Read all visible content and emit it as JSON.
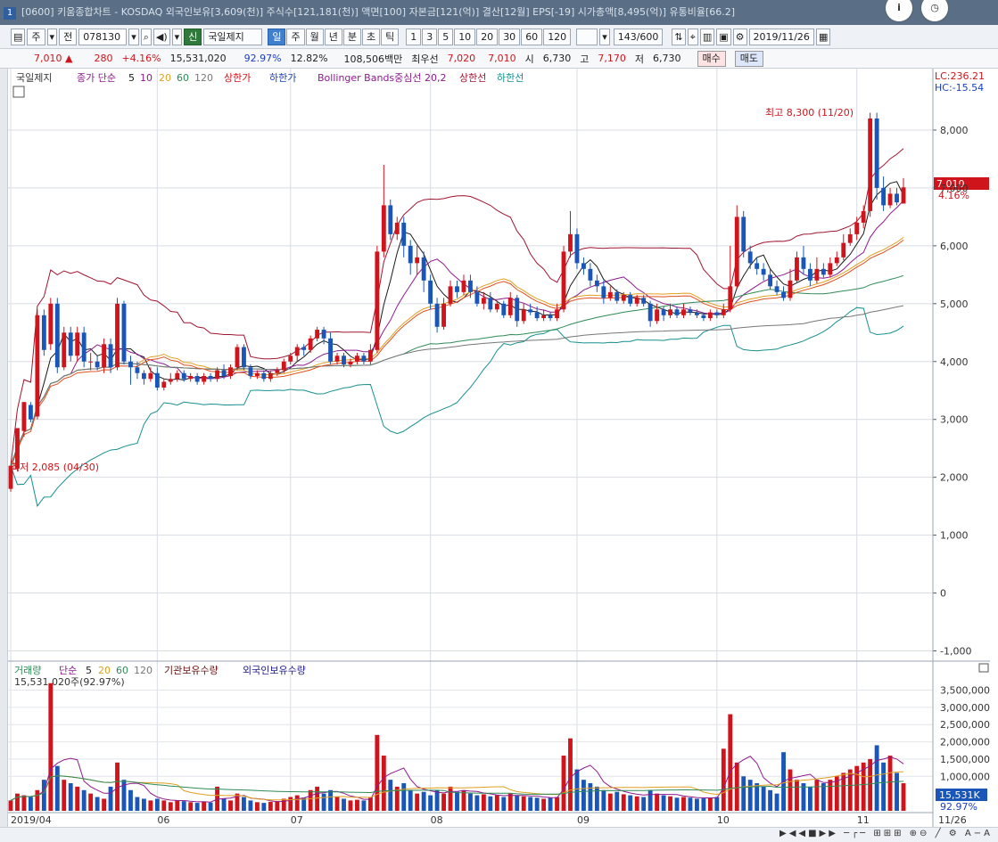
{
  "window": {
    "number": "1",
    "title": "[0600] 키움종합차트 - KOSDAQ 외국인보유[3,609(천)] 주식수[121,181(천)] 액면[100] 자본금[121(억)] 결산[12월] EPS[-19] 시가총액[8,495(억)] 유통비율[66.2]"
  },
  "toolbar": {
    "period_select": "주",
    "range_button": "전",
    "code": "078130",
    "stock_name": "국일제지",
    "period_buttons": [
      "일",
      "주",
      "월",
      "년",
      "분",
      "초",
      "틱"
    ],
    "selected_period": "일",
    "intervals": [
      "1",
      "3",
      "5",
      "10",
      "20",
      "30",
      "60",
      "120"
    ],
    "count": "143/600",
    "date": "2019/11/26",
    "new_badge": "신"
  },
  "quote": {
    "price": "7,010",
    "arrow": "▲",
    "change": "280",
    "change_pct": "+4.16%",
    "volume": "15,531,020",
    "volume_ratio": "92.97%",
    "turnover": "12.82%",
    "amount": "108,506백만",
    "best_ask_label": "최우선",
    "best_ask": "7,020",
    "best_bid": "7,010",
    "open_label": "시",
    "open": "6,730",
    "high_label": "고",
    "high": "7,170",
    "low_label": "저",
    "low": "6,730",
    "buy": "매수",
    "sell": "매도"
  },
  "legend": {
    "name": "국일제지",
    "close_ma": "종가 단순",
    "ma_periods": [
      "5",
      "10",
      "20",
      "60",
      "120"
    ],
    "upper_limit": "상한가",
    "lower_limit": "하한가",
    "bollinger": "Bollinger Bands중심선 20,2",
    "bb_upper": "상한선",
    "bb_lower": "하한선",
    "lc": "LC:236.21",
    "hc": "HC:-15.54"
  },
  "volume_legend": {
    "name": "거래량",
    "ma": "단순",
    "periods": [
      "5",
      "20",
      "60",
      "120"
    ],
    "inst": "기관보유수량",
    "foreign": "외국인보유수량",
    "current": "15,531,020주(92.97%)"
  },
  "annotations": {
    "high": "최고 8,300 (11/20)",
    "low": "최저 2,085 (04/30)",
    "current_price": "7,010",
    "current_pct": "4.16%",
    "current_volume": "15,531K",
    "current_volume_pct": "92.97%"
  },
  "colors": {
    "up": "#d0141b",
    "down": "#1a56b8",
    "ma5": "#1a1a1a",
    "ma10": "#8e1a8e",
    "ma20": "#e0a020",
    "ma60": "#2e8b57",
    "ma120": "#777777",
    "bb_upper": "#a01530",
    "bb_lower": "#178f8f",
    "inst": "#6b0f0f",
    "foreign": "#1e1a8c"
  },
  "chart_data": {
    "type": "candlestick",
    "y_axis_ticks": [
      "8,000",
      "7,000",
      "6,000",
      "5,000",
      "4,000",
      "3,000",
      "2,000",
      "1,000",
      "0",
      "-1,000"
    ],
    "ylim": [
      -1100,
      8600
    ],
    "x_axis_labels": [
      "2019/04",
      "06",
      "07",
      "08",
      "09",
      "10",
      "11",
      "11/26"
    ],
    "volume_axis_ticks": [
      "3,500,000",
      "3,000,000",
      "2,500,000",
      "2,000,000",
      "1,500,000",
      "1,000,000"
    ],
    "vol_ylim": [
      0,
      3900000
    ],
    "candles": [
      [
        1800,
        2200,
        1750,
        2150
      ],
      [
        2150,
        2850,
        2100,
        2800
      ],
      [
        2800,
        3300,
        2700,
        3250
      ],
      [
        3250,
        3000,
        2950,
        3300
      ],
      [
        3050,
        4800,
        3000,
        4900
      ],
      [
        4800,
        4200,
        4100,
        4900
      ],
      [
        4300,
        5000,
        4200,
        5100
      ],
      [
        5000,
        3900,
        3800,
        5100
      ],
      [
        3900,
        4500,
        3850,
        4600
      ],
      [
        4500,
        4100,
        4000,
        4600
      ],
      [
        4100,
        4500,
        4000,
        4600
      ],
      [
        4500,
        4000,
        3900,
        4600
      ],
      [
        4000,
        4000,
        3850,
        4150
      ],
      [
        4000,
        3900,
        3850,
        4100
      ],
      [
        3900,
        4300,
        3800,
        4400
      ],
      [
        4300,
        3900,
        3800,
        4400
      ],
      [
        3900,
        5000,
        3850,
        5100
      ],
      [
        5000,
        4000,
        3950,
        5050
      ],
      [
        4000,
        3900,
        3600,
        4100
      ],
      [
        3900,
        3800,
        3700,
        4000
      ],
      [
        3800,
        3700,
        3600,
        3850
      ],
      [
        3700,
        3800,
        3650,
        3900
      ],
      [
        3800,
        3550,
        3500,
        3900
      ],
      [
        3550,
        3650,
        3500,
        3700
      ],
      [
        3650,
        3700,
        3600,
        3800
      ],
      [
        3700,
        3800,
        3650,
        3850
      ],
      [
        3800,
        3700,
        3650,
        3850
      ],
      [
        3700,
        3750,
        3650,
        3800
      ],
      [
        3750,
        3650,
        3600,
        3800
      ],
      [
        3650,
        3750,
        3600,
        3800
      ],
      [
        3750,
        3700,
        3650,
        3800
      ],
      [
        3700,
        3850,
        3650,
        3900
      ],
      [
        3850,
        3750,
        3700,
        3950
      ],
      [
        3750,
        3900,
        3700,
        3950
      ],
      [
        3900,
        4250,
        3850,
        4300
      ],
      [
        4250,
        3900,
        3850,
        4300
      ],
      [
        3900,
        3750,
        3700,
        3950
      ],
      [
        3750,
        3800,
        3700,
        3850
      ],
      [
        3800,
        3700,
        3650,
        3850
      ],
      [
        3700,
        3800,
        3650,
        3850
      ],
      [
        3800,
        3850,
        3750,
        3900
      ],
      [
        3850,
        4000,
        3800,
        4050
      ],
      [
        4000,
        4100,
        3950,
        4150
      ],
      [
        4100,
        4250,
        4000,
        4300
      ],
      [
        4250,
        4200,
        4100,
        4300
      ],
      [
        4200,
        4400,
        4150,
        4450
      ],
      [
        4400,
        4550,
        4350,
        4600
      ],
      [
        4550,
        4400,
        4300,
        4600
      ],
      [
        4400,
        4000,
        3950,
        4500
      ],
      [
        4000,
        4100,
        3950,
        4150
      ],
      [
        4100,
        3950,
        3900,
        4150
      ],
      [
        3950,
        4000,
        3900,
        4050
      ],
      [
        4000,
        4100,
        3950,
        4150
      ],
      [
        4100,
        4000,
        3950,
        4150
      ],
      [
        4000,
        4200,
        3950,
        4300
      ],
      [
        4200,
        5900,
        4150,
        6000
      ],
      [
        5900,
        6700,
        5800,
        7400
      ],
      [
        6700,
        6200,
        6100,
        6800
      ],
      [
        6200,
        6400,
        6100,
        6500
      ],
      [
        6400,
        6000,
        5800,
        6500
      ],
      [
        6000,
        5700,
        5500,
        6100
      ],
      [
        5700,
        5800,
        5500,
        6000
      ],
      [
        5800,
        5400,
        5200,
        5900
      ],
      [
        5400,
        5000,
        4900,
        5500
      ],
      [
        5000,
        4600,
        4500,
        5100
      ],
      [
        4600,
        5000,
        4550,
        5100
      ],
      [
        5000,
        5300,
        4950,
        5400
      ],
      [
        5300,
        5200,
        5100,
        5400
      ],
      [
        5200,
        5400,
        5150,
        5500
      ],
      [
        5400,
        5200,
        5100,
        5500
      ],
      [
        5200,
        5000,
        4950,
        5300
      ],
      [
        5000,
        5100,
        4900,
        5200
      ],
      [
        5100,
        4900,
        4850,
        5200
      ],
      [
        4900,
        5000,
        4850,
        5050
      ],
      [
        5000,
        4800,
        4750,
        5050
      ],
      [
        4800,
        5100,
        4750,
        5200
      ],
      [
        5100,
        4700,
        4600,
        5150
      ],
      [
        4700,
        4900,
        4650,
        5000
      ],
      [
        4900,
        4850,
        4800,
        5000
      ],
      [
        4850,
        4750,
        4700,
        4950
      ],
      [
        4750,
        4800,
        4700,
        4900
      ],
      [
        4800,
        4750,
        4700,
        4850
      ],
      [
        4750,
        4900,
        4700,
        5000
      ],
      [
        4900,
        5900,
        4850,
        6000
      ],
      [
        5900,
        6200,
        5800,
        6600
      ],
      [
        6200,
        5700,
        5600,
        6300
      ],
      [
        5700,
        5600,
        5500,
        5800
      ],
      [
        5600,
        5400,
        5300,
        5700
      ],
      [
        5400,
        5300,
        5200,
        5500
      ],
      [
        5300,
        5100,
        5000,
        5400
      ],
      [
        5100,
        5200,
        5050,
        5300
      ],
      [
        5200,
        5050,
        5000,
        5250
      ],
      [
        5050,
        5150,
        5000,
        5200
      ],
      [
        5150,
        5000,
        4950,
        5200
      ],
      [
        5000,
        5100,
        4950,
        5150
      ],
      [
        5100,
        5000,
        4950,
        5150
      ],
      [
        5000,
        4700,
        4600,
        5050
      ],
      [
        4700,
        4900,
        4650,
        5000
      ],
      [
        4900,
        4800,
        4700,
        4950
      ],
      [
        4800,
        4900,
        4750,
        5000
      ],
      [
        4900,
        4800,
        4750,
        4950
      ],
      [
        4800,
        4900,
        4750,
        5000
      ],
      [
        4900,
        4850,
        4800,
        4950
      ],
      [
        4850,
        4800,
        4750,
        4900
      ],
      [
        4800,
        4750,
        4700,
        4850
      ],
      [
        4750,
        4850,
        4700,
        4900
      ],
      [
        4850,
        4800,
        4750,
        4900
      ],
      [
        4800,
        4900,
        4750,
        5000
      ],
      [
        4900,
        5300,
        4850,
        6000
      ],
      [
        5300,
        6500,
        5250,
        6700
      ],
      [
        6500,
        5900,
        5800,
        6600
      ],
      [
        5900,
        5700,
        5600,
        6000
      ],
      [
        5700,
        5600,
        5500,
        5800
      ],
      [
        5600,
        5500,
        5400,
        5700
      ],
      [
        5500,
        5300,
        5250,
        5600
      ],
      [
        5300,
        5200,
        5150,
        5400
      ],
      [
        5200,
        5100,
        5050,
        5300
      ],
      [
        5100,
        5400,
        5050,
        5600
      ],
      [
        5400,
        5800,
        5350,
        5900
      ],
      [
        5800,
        5600,
        5500,
        6000
      ],
      [
        5600,
        5400,
        5300,
        5700
      ],
      [
        5400,
        5600,
        5350,
        5800
      ],
      [
        5600,
        5500,
        5450,
        5700
      ],
      [
        5500,
        5700,
        5450,
        5800
      ],
      [
        5700,
        5800,
        5650,
        5900
      ],
      [
        5800,
        6050,
        5750,
        6200
      ],
      [
        6050,
        6200,
        6000,
        6300
      ],
      [
        6200,
        6400,
        6100,
        6500
      ],
      [
        6400,
        6600,
        6300,
        6700
      ],
      [
        6600,
        8200,
        6500,
        8300
      ],
      [
        8200,
        7000,
        6800,
        8300
      ],
      [
        7000,
        6700,
        6600,
        7200
      ],
      [
        6700,
        6900,
        6650,
        7000
      ],
      [
        6900,
        6750,
        6700,
        7000
      ],
      [
        6730,
        7010,
        6730,
        7170
      ]
    ],
    "volume": [
      300000,
      500000,
      450000,
      400000,
      600000,
      900000,
      3700000,
      1300000,
      900000,
      800000,
      700000,
      600000,
      500000,
      400000,
      350000,
      700000,
      1400000,
      900000,
      600000,
      400000,
      350000,
      300000,
      350000,
      300000,
      250000,
      300000,
      280000,
      250000,
      230000,
      260000,
      240000,
      700000,
      350000,
      300000,
      500000,
      400000,
      300000,
      250000,
      230000,
      260000,
      280000,
      350000,
      400000,
      450000,
      380000,
      600000,
      700000,
      500000,
      600000,
      400000,
      350000,
      300000,
      320000,
      300000,
      400000,
      2200000,
      1600000,
      900000,
      700000,
      800000,
      600000,
      500000,
      550000,
      450000,
      600000,
      500000,
      700000,
      550000,
      600000,
      500000,
      450000,
      480000,
      420000,
      450000,
      400000,
      500000,
      450000,
      420000,
      400000,
      380000,
      350000,
      380000,
      400000,
      1600000,
      2100000,
      1200000,
      900000,
      800000,
      700000,
      600000,
      500000,
      550000,
      480000,
      450000,
      420000,
      400000,
      600000,
      500000,
      450000,
      420000,
      380000,
      400000,
      380000,
      350000,
      360000,
      380000,
      400000,
      1800000,
      2800000,
      1400000,
      1000000,
      900000,
      800000,
      700000,
      600000,
      500000,
      1700000,
      1200000,
      900000,
      800000,
      700000,
      900000,
      800000,
      900000,
      1000000,
      1100000,
      1200000,
      1300000,
      1400000,
      1500000,
      1900000,
      1400000,
      1600000,
      1100000,
      800000
    ]
  }
}
